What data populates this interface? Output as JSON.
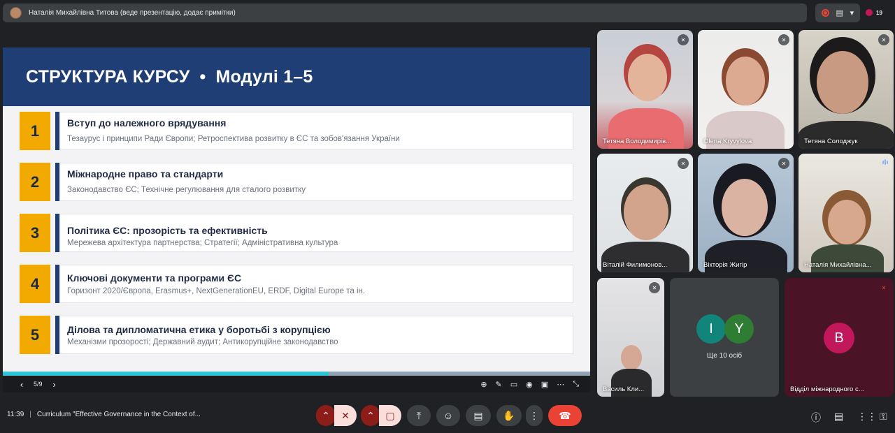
{
  "topbar": {
    "presenter_text": "Наталія Михайлівна Титова (веде презентацію, додає примітки)",
    "participants_count": "19"
  },
  "slide": {
    "title_left": "СТРУКТУРА КУРСУ",
    "title_sep": "•",
    "title_right": "Модулі 1–5",
    "modules": [
      {
        "num": "1",
        "title": "Вступ до належного врядування",
        "desc": "Тезаурус і принципи Ради Європи; Ретроспектива розвитку в ЄС та зобов'язання України"
      },
      {
        "num": "2",
        "title": "Міжнародне право та стандарти",
        "desc": "Законодавство ЄС; Технічне регулювання для сталого розвитку"
      },
      {
        "num": "3",
        "title": "Політика ЄС: прозорість та ефективність",
        "desc": "Мережева архітектура партнерства; Стратегії; Адміністративна культура"
      },
      {
        "num": "4",
        "title": "Ключові документи та програми ЄС",
        "desc": "Горизонт 2020/Європа, Erasmus+, NextGenerationEU, ERDF, Digital Europe та ін."
      },
      {
        "num": "5",
        "title": "Ділова та дипломатична етика у боротьбі з корупцією",
        "desc": "Механізми прозорості; Державний аудит; Антикорупційне законодавство"
      }
    ],
    "progress_fraction": 0.555
  },
  "slide_toolbar": {
    "prev": "‹",
    "page": "5/9",
    "next": "›",
    "icons": [
      "zoom-icon",
      "laser-icon",
      "captions-icon",
      "broadcast-icon",
      "screens-icon",
      "more-icon",
      "exit-fullscreen-icon"
    ]
  },
  "participants": [
    {
      "name": "Тетяна Володимирів...",
      "muted": true
    },
    {
      "name": "Olena Kryvylova",
      "muted": true
    },
    {
      "name": "Тетяна Солоджук",
      "muted": true
    },
    {
      "name": "Віталій Филимонов...",
      "muted": true
    },
    {
      "name": "Вікторія Жигір",
      "muted": true
    },
    {
      "name": "Наталія Михайлівна...",
      "muted": false
    },
    {
      "name": "Василь Кли...",
      "muted": true
    },
    {
      "name": "Відділ міжнародного с...",
      "muted": true
    }
  ],
  "more": {
    "letters": [
      "I",
      "Y"
    ],
    "label": "Ще 10 осіб"
  },
  "b_avatar": "B",
  "bottombar": {
    "time": "11:39",
    "separator": "|",
    "meeting_title": "Curriculum \"Effective Governance in the Context of..."
  },
  "colors": {
    "header_blue": "#1f3e75",
    "module_yellow": "#f2a900",
    "hangup_red": "#ea4335",
    "avatar_i": "#12857a",
    "avatar_y": "#2e7d32",
    "avatar_b": "#c2185b"
  }
}
